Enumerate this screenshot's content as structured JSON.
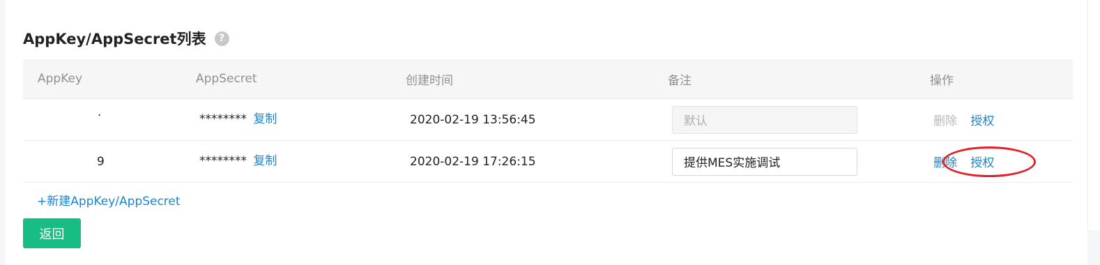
{
  "page": {
    "title": "AppKey/AppSecret列表",
    "help_icon": "?"
  },
  "table": {
    "headers": [
      "AppKey",
      "AppSecret",
      "创建时间",
      "备注",
      "操作"
    ],
    "rows": [
      {
        "appkey": "·",
        "appsecret": "********",
        "copy_label": "复制",
        "created": "2020-02-19 13:56:45",
        "remark": "默认",
        "delete_label": "删除",
        "auth_label": "授权"
      },
      {
        "appkey": "9",
        "appsecret": "********",
        "copy_label": "复制",
        "created": "2020-02-19 17:26:15",
        "remark": "提供MES实施调试",
        "delete_label": "删除",
        "auth_label": "授权"
      }
    ]
  },
  "actions": {
    "new_label": "+新建AppKey/AppSecret",
    "back_label": "返回"
  },
  "colors": {
    "accent_link": "#1a86d0",
    "primary_button": "#18bd84",
    "annotation": "#e3202a"
  }
}
